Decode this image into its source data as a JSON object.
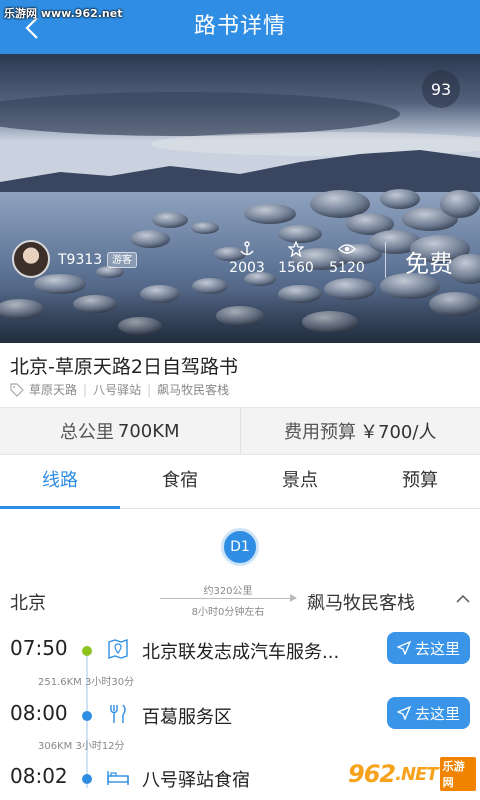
{
  "watermark": {
    "site": "乐游网 www.962.net",
    "logo": "962",
    "logo_suffix": ".NET",
    "logo_text": "乐游网"
  },
  "header": {
    "title": "路书详情",
    "back_icon": "back-arrow-icon",
    "color": "#2f8ee3"
  },
  "hero": {
    "score": "93",
    "user": {
      "name": "T9313",
      "tag": "游客"
    },
    "stats": [
      {
        "icon": "anchor-icon",
        "value": "2003"
      },
      {
        "icon": "star-icon",
        "value": "1560"
      },
      {
        "icon": "eye-icon",
        "value": "5120"
      }
    ],
    "price": "免费"
  },
  "route": {
    "title": "北京-草原天路2日自驾路书",
    "tags": [
      "草原天路",
      "八号驿站",
      "飙马牧民客栈"
    ]
  },
  "summary": {
    "distance_label": "总公里",
    "distance_value": "700KM",
    "budget_label": "费用预算",
    "budget_value": "￥700/人"
  },
  "tabs": [
    {
      "label": "线路",
      "active": true
    },
    {
      "label": "食宿",
      "active": false
    },
    {
      "label": "景点",
      "active": false
    },
    {
      "label": "预算",
      "active": false
    }
  ],
  "day": {
    "badge": "D1",
    "from": "北京",
    "to": "飙马牧民客栈",
    "distance": "约320公里",
    "duration": "8小时0分钟左右"
  },
  "stops": [
    {
      "time": "07:50",
      "icon": "map-icon",
      "name": "北京联发志成汽车服务...",
      "button": "去这里",
      "dot": "green"
    },
    {
      "time": "08:00",
      "icon": "restaurant-icon",
      "name": "百葛服务区",
      "button": "去这里",
      "dot": "blue"
    },
    {
      "time": "08:02",
      "icon": "bed-icon",
      "name": "八号驿站食宿",
      "button": "",
      "dot": "blue"
    }
  ],
  "segments": [
    {
      "text": "251.6KM 3小时30分"
    },
    {
      "text": "306KM 3小时12分"
    }
  ]
}
